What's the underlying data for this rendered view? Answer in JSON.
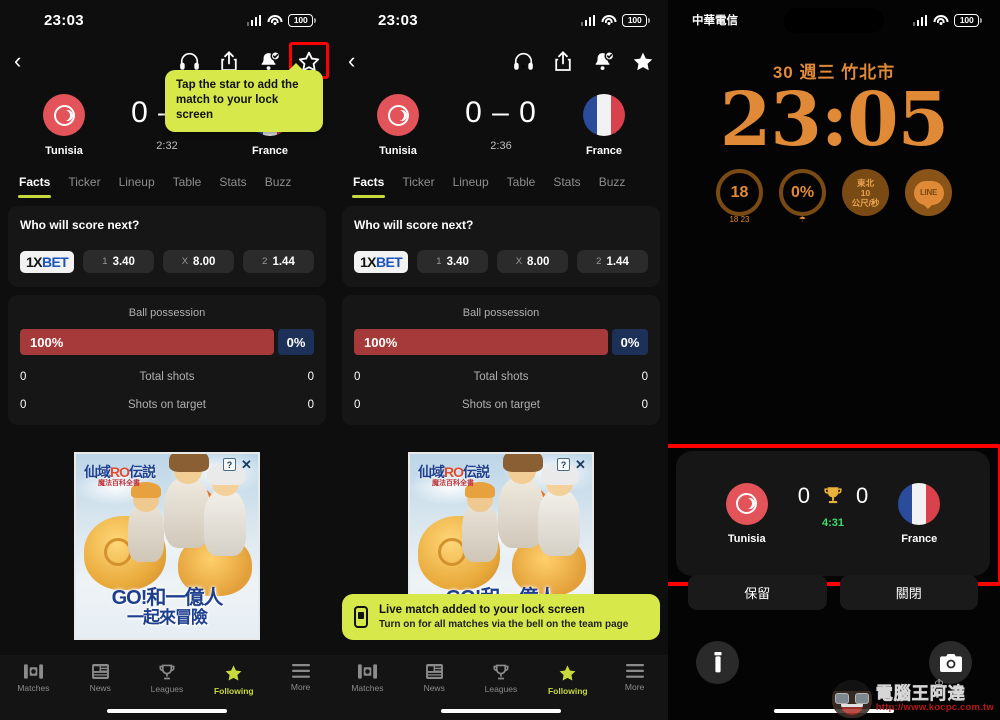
{
  "panel1": {
    "statusbar": {
      "time": "23:03",
      "battery": "100",
      "wifi_icon": "wifi-icon",
      "signal_icon": "cellular-signal-icon"
    },
    "topbar": {
      "back_icon": "back-chevron-icon",
      "icons": [
        "headphones-icon",
        "share-icon",
        "bell-check-icon",
        "star-outline-icon"
      ]
    },
    "tooltip": {
      "text": "Tap the star to add the match to your lock screen"
    },
    "match": {
      "home_team": "Tunisia",
      "away_team": "France",
      "score": "0 – 0",
      "clock": "2:32",
      "home_flag_icon": "tunisia-flag-icon",
      "away_flag_icon": "france-flag-icon"
    },
    "tabs": [
      {
        "label": "Facts",
        "active": true
      },
      {
        "label": "Ticker",
        "active": false
      },
      {
        "label": "Lineup",
        "active": false
      },
      {
        "label": "Table",
        "active": false
      },
      {
        "label": "Stats",
        "active": false
      },
      {
        "label": "Buzz",
        "active": false
      }
    ],
    "bet_card": {
      "title": "Who will score next?",
      "logo_part1": "1X",
      "logo_part2": "BET",
      "odds": [
        {
          "key": "1",
          "value": "3.40"
        },
        {
          "key": "X",
          "value": "8.00"
        },
        {
          "key": "2",
          "value": "1.44"
        }
      ]
    },
    "stats_card": {
      "possession_label": "Ball possession",
      "possession_home": "100%",
      "possession_away": "0%",
      "rows": [
        {
          "home": "0",
          "label": "Total shots",
          "away": "0"
        },
        {
          "home": "0",
          "label": "Shots on target",
          "away": "0"
        }
      ]
    },
    "ad": {
      "title_cn": "仙域",
      "title_r": "RO",
      "title_cn2": "伝説",
      "subtitle": "魔法百科全書",
      "slogan_line1": "GO!和一億人",
      "slogan_line2": "一起來冒險",
      "info_icon": "ad-info-icon",
      "close_icon": "ad-close-icon"
    },
    "nav": [
      {
        "label": "Matches",
        "icon": "pitch-icon",
        "active": false
      },
      {
        "label": "News",
        "icon": "news-icon",
        "active": false
      },
      {
        "label": "Leagues",
        "icon": "trophy-icon",
        "active": false
      },
      {
        "label": "Following",
        "icon": "star-filled-icon",
        "active": true
      },
      {
        "label": "More",
        "icon": "hamburger-icon",
        "active": false
      }
    ]
  },
  "panel2": {
    "statusbar": {
      "time": "23:03",
      "battery": "100"
    },
    "match": {
      "home_team": "Tunisia",
      "away_team": "France",
      "score": "0 – 0",
      "clock": "2:36"
    },
    "toast": {
      "title": "Live match added to your lock screen",
      "subtitle": "Turn on for all matches via the bell on the team page",
      "icon": "phone-lockscreen-icon"
    }
  },
  "panel3": {
    "statusbar": {
      "carrier": "中華電信",
      "battery": "100"
    },
    "date": "30 週三  竹北市",
    "weather_icon": "wind-icon",
    "time": "23:05",
    "widgets": [
      {
        "name": "temperature-widget",
        "value": "18",
        "sub": "18   23"
      },
      {
        "name": "rain-chance-widget",
        "value": "0%",
        "sub": "umbrella-icon"
      },
      {
        "name": "wind-widget",
        "lines": [
          "東北",
          "10",
          "公尺/秒"
        ]
      },
      {
        "name": "line-app-widget",
        "label": "LINE"
      }
    ],
    "live_activity": {
      "home_team": "Tunisia",
      "away_team": "France",
      "home_score": "0",
      "away_score": "0",
      "minute": "4:31",
      "center_icon": "trophy-icon"
    },
    "buttons": [
      {
        "label": "保留",
        "name": "keep-button"
      },
      {
        "label": "關閉",
        "name": "close-button"
      }
    ],
    "controls": [
      {
        "name": "flashlight-button",
        "icon": "flashlight-icon"
      },
      {
        "name": "camera-button",
        "icon": "camera-icon"
      }
    ],
    "watermark": {
      "text": "電腦王阿達",
      "url": "http://www.kocpc.com.tw"
    }
  },
  "colors": {
    "accent_lime": "#c7d93c",
    "tooltip_bg": "#d7e84a",
    "highlight_red": "#ff0000",
    "possession_home": "#a63a3a",
    "possession_away": "#1d3158",
    "lock_orange": "#e08a38",
    "live_green": "#3ddc6e"
  }
}
